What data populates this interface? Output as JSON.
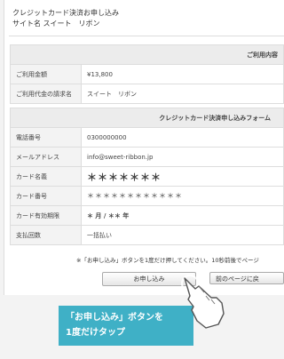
{
  "header": {
    "title_line1": "クレジットカード決済お申し込み",
    "title_line2": "サイト名 スイート　リボン"
  },
  "usage_section": {
    "heading": "ご利用内容",
    "rows": [
      {
        "label": "ご利用金額",
        "value": "¥13,800"
      },
      {
        "label": "ご利用代金の請求名",
        "value": "スイート　リボン"
      }
    ]
  },
  "form_section": {
    "heading": "クレジットカード決済申し込みフォーム",
    "rows": [
      {
        "label": "電話番号",
        "value": "0300000000"
      },
      {
        "label": "メールアドレス",
        "value": "info@sweet-ribbon.jp"
      },
      {
        "label": "カード名義",
        "value": "＊＊＊＊＊＊＊"
      },
      {
        "label": "カード番号",
        "value": "＊＊＊＊＊＊＊＊＊＊＊＊"
      },
      {
        "label": "カード有効期限",
        "value": "＊ 月 / ＊＊ 年"
      },
      {
        "label": "支払回数",
        "value": "一括払い"
      }
    ]
  },
  "notice": "※「お申し込み」ボタンを1度だけ押してください。10秒前後でページ",
  "buttons": {
    "apply": "お申し込み",
    "back": "前のページに戻"
  },
  "callout": {
    "line1": "「お申し込み」ボタンを",
    "line2": "1度だけタップ"
  },
  "colors": {
    "callout_bg": "#3fb0c6",
    "panel_bg": "#ffffff",
    "page_bg": "#f3f3f3"
  }
}
